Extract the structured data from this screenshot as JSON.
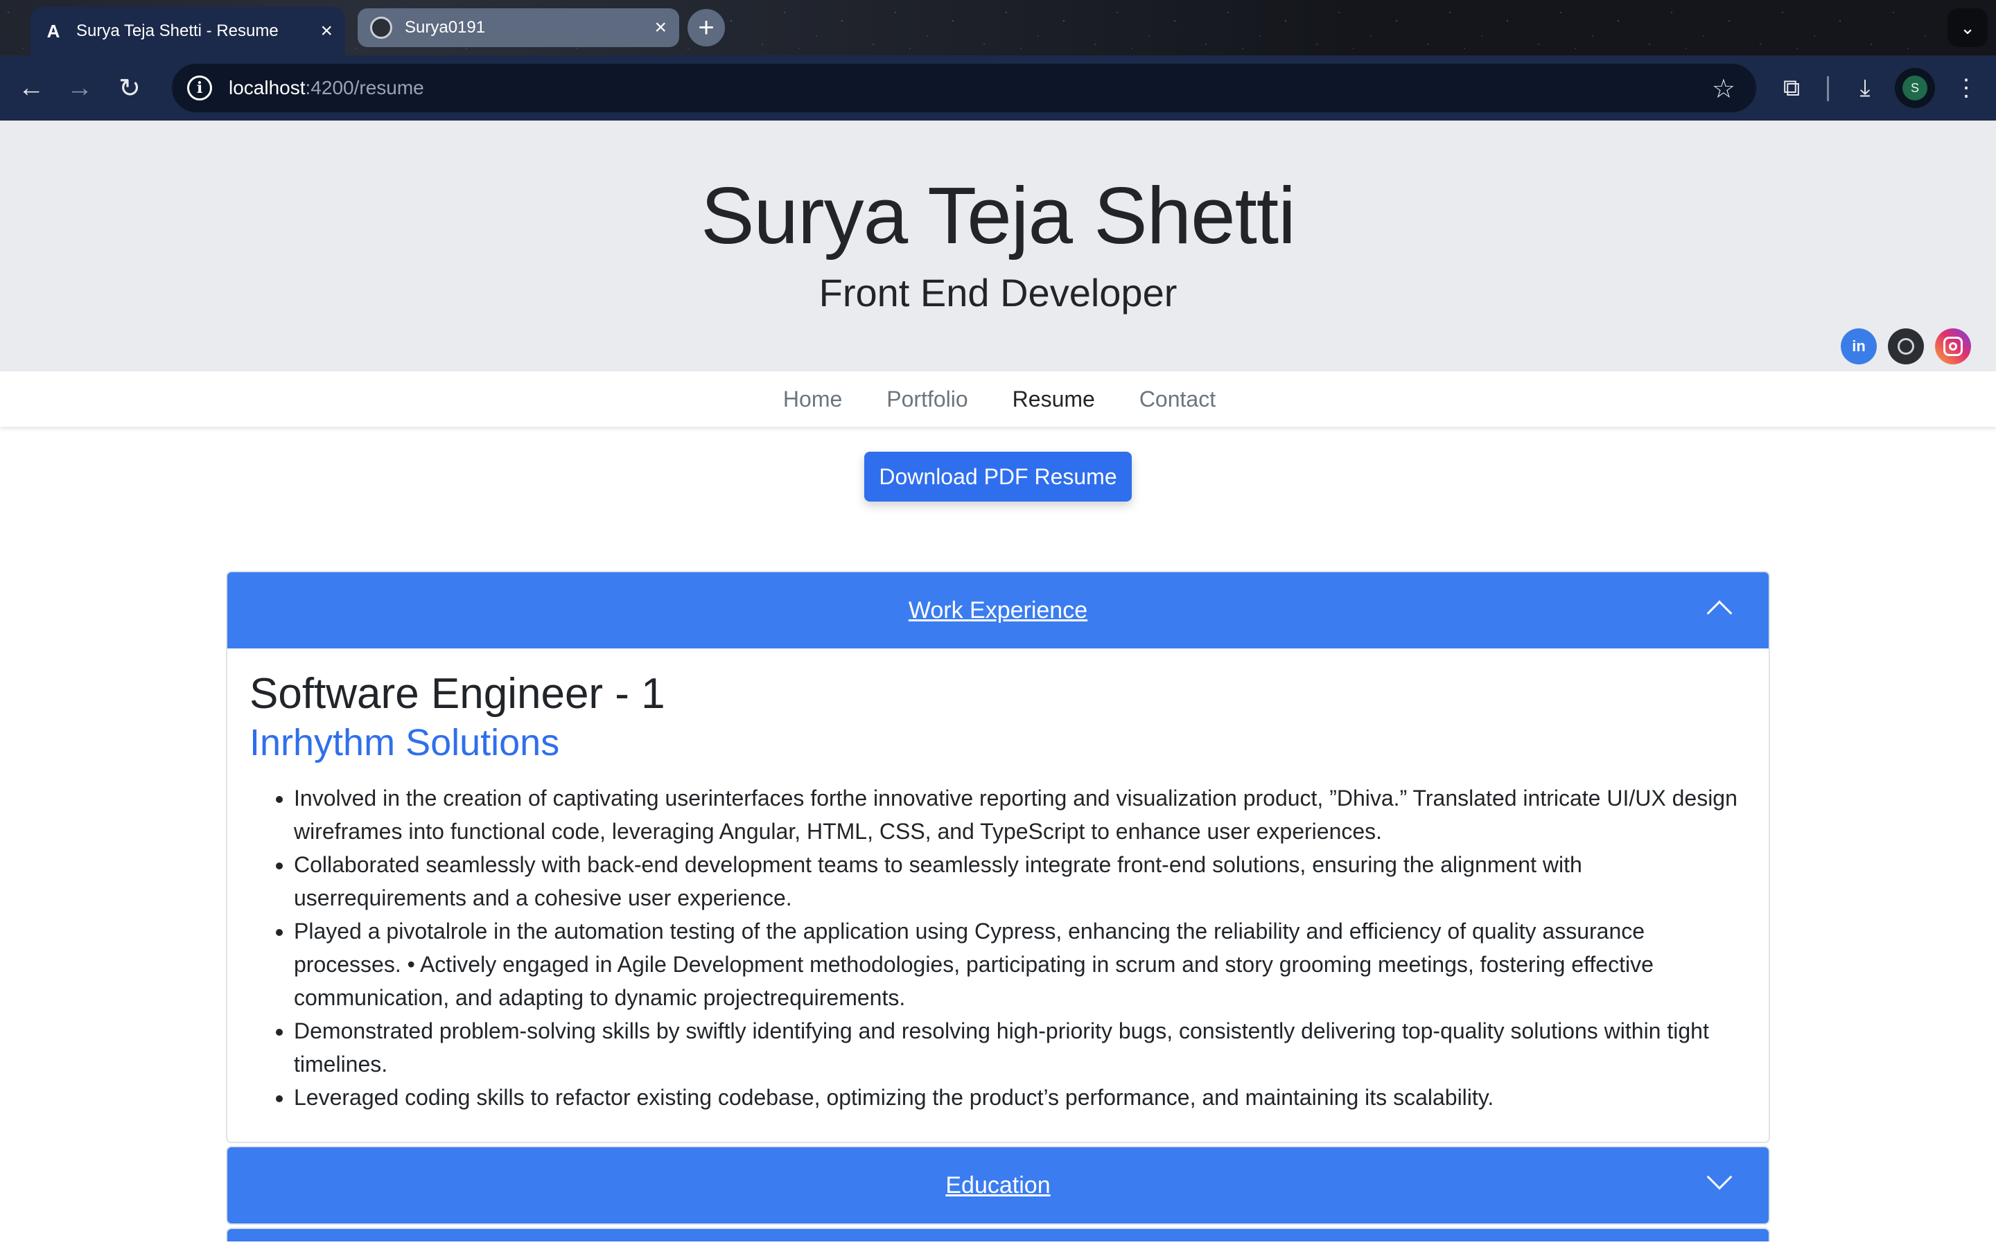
{
  "browser": {
    "tabs": [
      {
        "title": "Surya Teja Shetti - Resume",
        "favicon": "angular-icon",
        "active": true
      },
      {
        "title": "Surya0191",
        "favicon": "github-icon",
        "active": false
      }
    ],
    "new_tab_symbol": "+",
    "tab_close_symbol": "×",
    "url_host": "localhost",
    "url_path": ":4200/resume",
    "profile_initial": "S",
    "icons": [
      "back-icon",
      "forward-icon",
      "reload-icon",
      "info-icon",
      "bookmark-star-icon",
      "extensions-icon",
      "download-icon",
      "menu-icon"
    ]
  },
  "header": {
    "name": "Surya Teja Shetti",
    "role": "Front End Developer",
    "social": [
      "linkedin-icon",
      "github-icon",
      "instagram-icon"
    ],
    "linkedin_label": "in"
  },
  "nav": {
    "items": [
      {
        "label": "Home",
        "active": false
      },
      {
        "label": "Portfolio",
        "active": false
      },
      {
        "label": "Resume",
        "active": true
      },
      {
        "label": "Contact",
        "active": false
      }
    ]
  },
  "download_label": "Download PDF Resume",
  "accordion": {
    "sections": [
      {
        "label": "Work Experience",
        "expanded": true
      },
      {
        "label": "Education",
        "expanded": false
      }
    ],
    "work": {
      "title": "Software Engineer - 1",
      "company": "Inrhythm Solutions",
      "bullets": [
        "Involved in the creation of captivating userinterfaces forthe innovative reporting and visualization product, ”Dhiva.” Translated intricate UI/UX design wireframes into functional code, leveraging Angular, HTML, CSS, and TypeScript to enhance user experiences.",
        "Collaborated seamlessly with back-end development teams to seamlessly integrate front-end solutions, ensuring the alignment with userrequirements and a cohesive user experience.",
        "Played a pivotalrole in the automation testing of the application using Cypress, enhancing the reliability and efficiency of quality assurance processes. • Actively engaged in Agile Development methodologies, participating in scrum and story grooming meetings, fostering effective communication, and adapting to dynamic projectrequirements.",
        "Demonstrated problem-solving skills by swiftly identifying and resolving high-priority bugs, consistently delivering top-quality solutions within tight timelines.",
        "Leveraged coding skills to refactor existing codebase, optimizing the product’s performance, and maintaining its scalability."
      ]
    }
  },
  "colors": {
    "accent": "#3b7cf0",
    "button": "#2f6fed",
    "hero_bg": "#e9ebef",
    "chrome": "#1b2a4a"
  }
}
